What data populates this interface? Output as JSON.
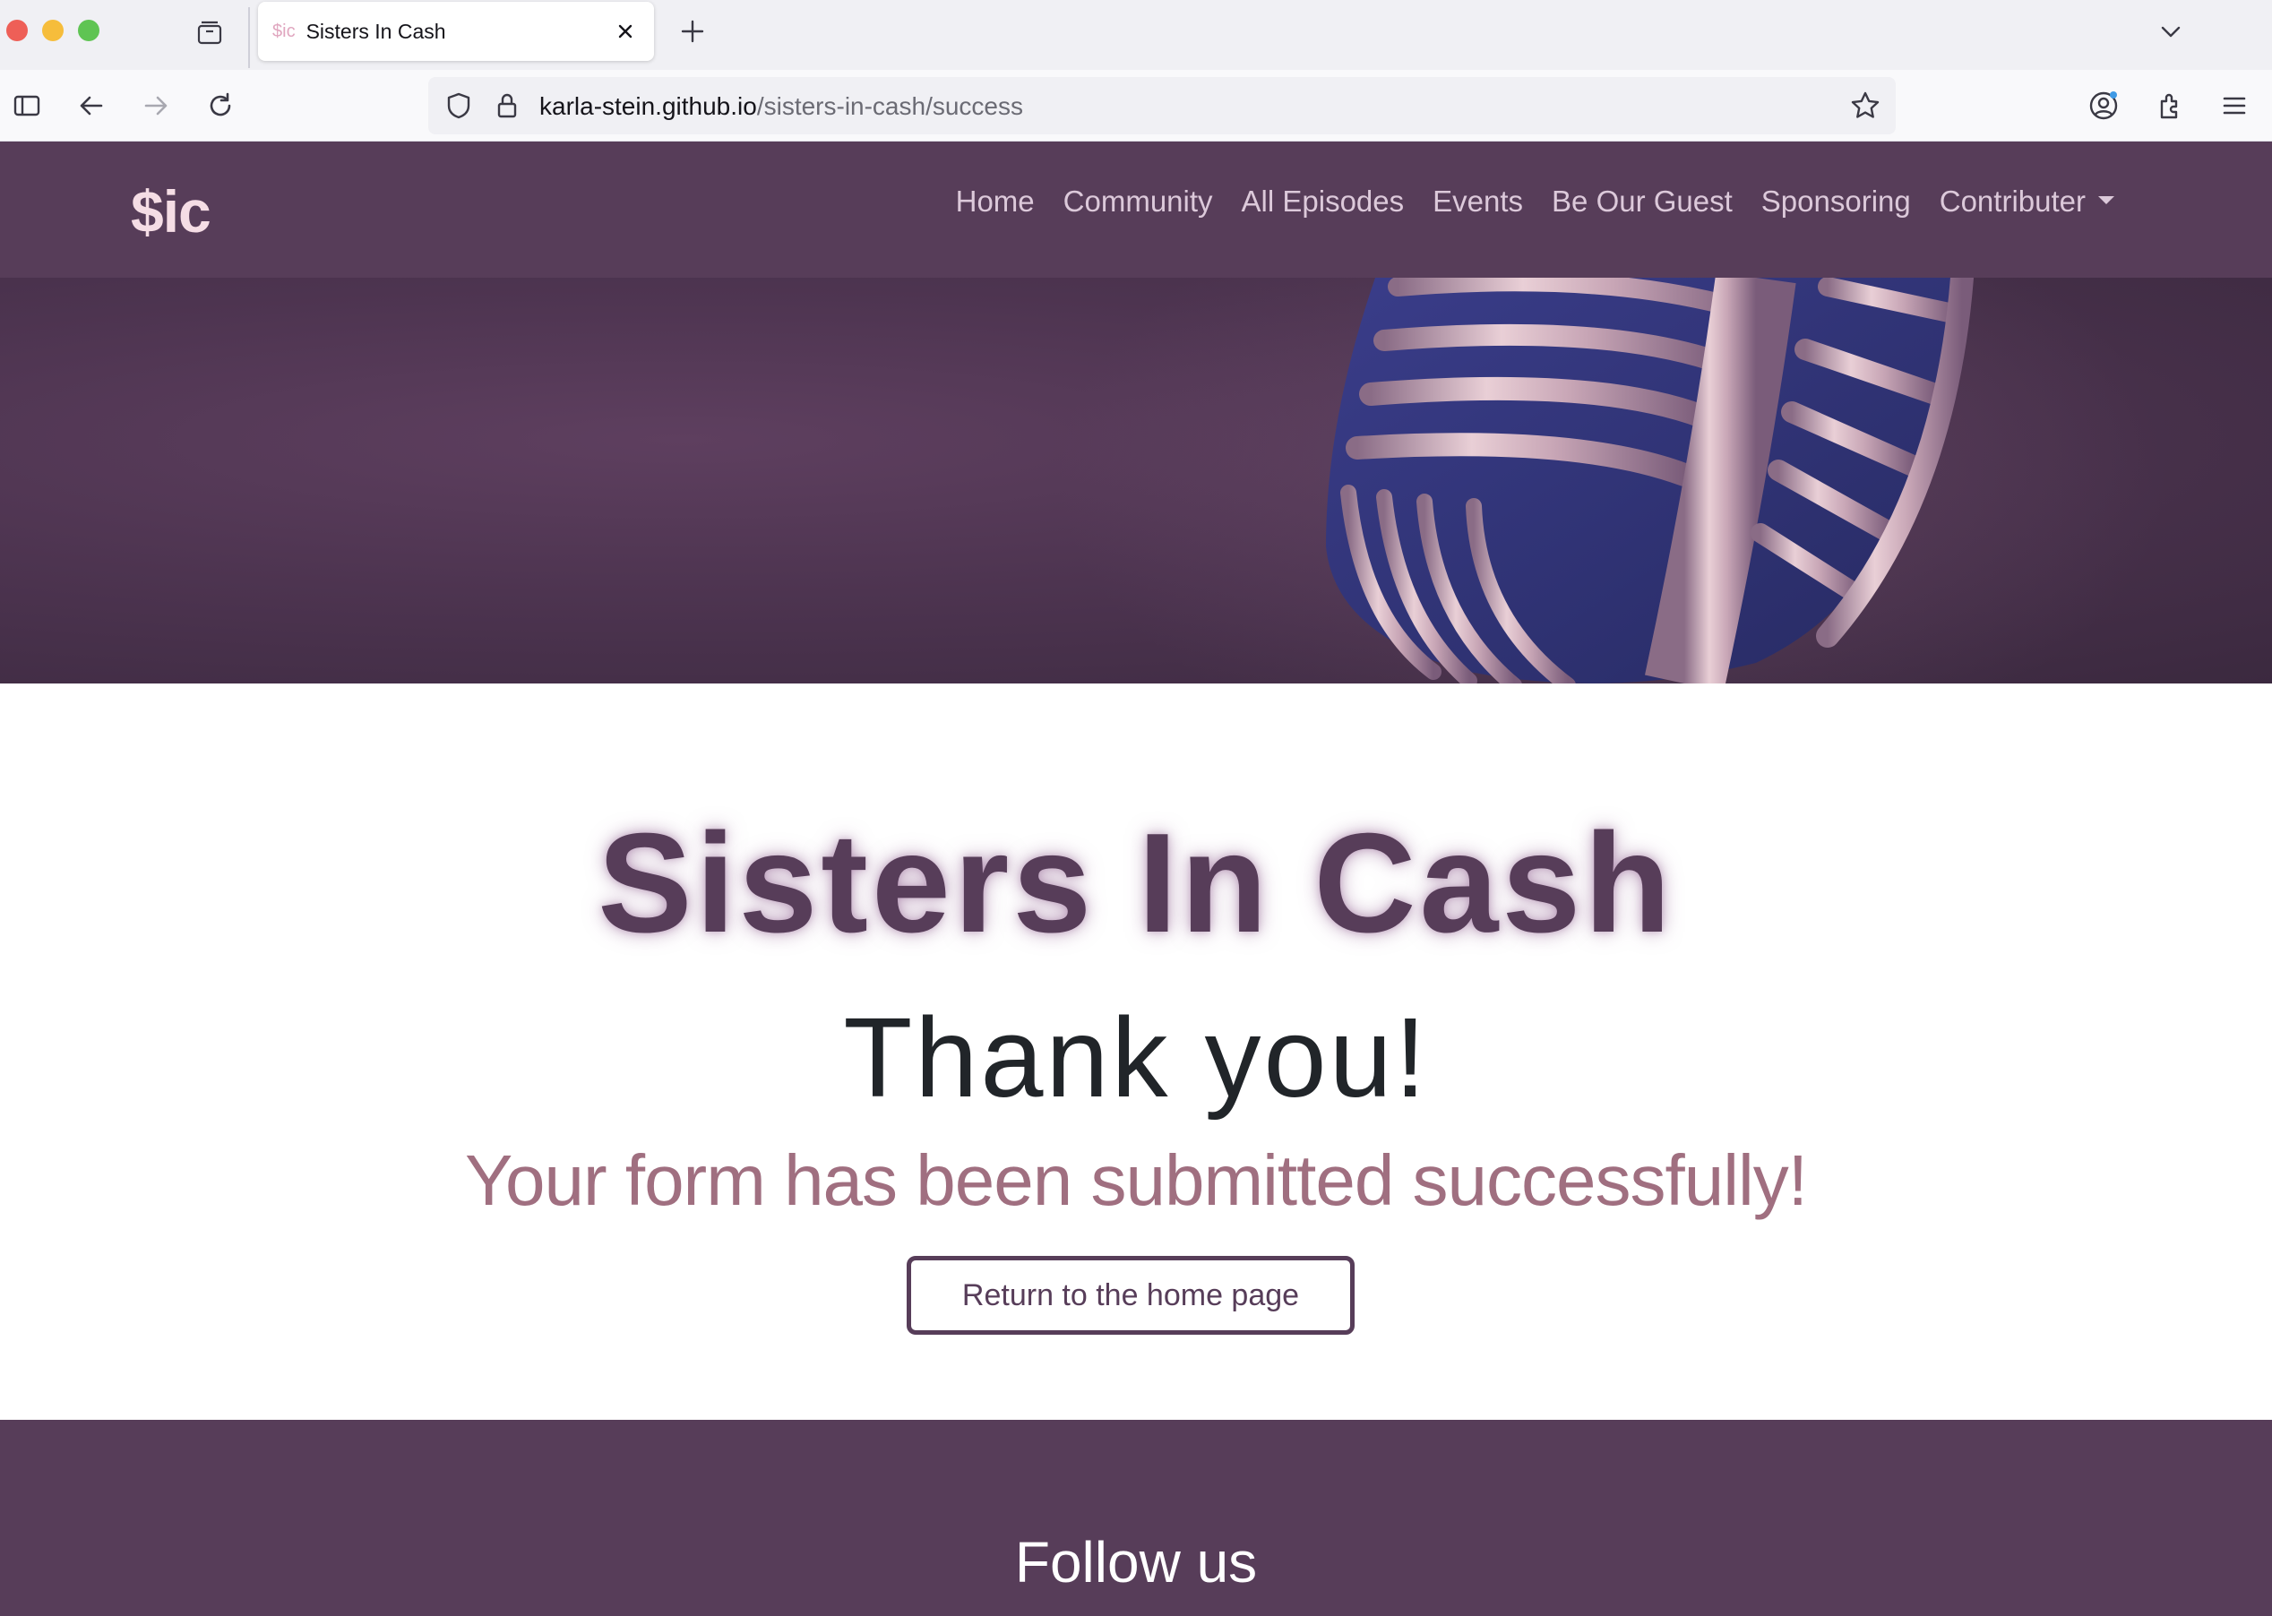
{
  "browser": {
    "tab": {
      "favicon_text": "$ic",
      "title": "Sisters In Cash"
    },
    "url": {
      "host": "karla-stein.github.io",
      "path": "/sisters-in-cash/success"
    },
    "icons": [
      "sidebar-icon",
      "back-icon",
      "forward-icon",
      "reload-icon",
      "shield-icon",
      "lock-icon",
      "star-icon",
      "account-icon",
      "extensions-icon",
      "menu-icon",
      "tab-groups-icon",
      "close-icon",
      "plus-icon",
      "chevron-down-icon"
    ]
  },
  "site": {
    "brand": "$ic",
    "nav": {
      "links": [
        "Home",
        "Community",
        "All Episodes",
        "Events",
        "Be Our Guest",
        "Sponsoring"
      ],
      "dropdown_label": "Contributer"
    },
    "hero": {
      "image": "microphone-photo"
    },
    "main": {
      "title": "Sisters In Cash",
      "thanks": "Thank you!",
      "message": "Your form has been submitted successfully!",
      "button_label": "Return to the home page"
    },
    "footer": {
      "heading": "Follow us"
    },
    "colors": {
      "primary": "#573d59",
      "accent": "#a06f80",
      "brand_text": "#f5dde5",
      "nav_text": "#dcc9da"
    }
  }
}
